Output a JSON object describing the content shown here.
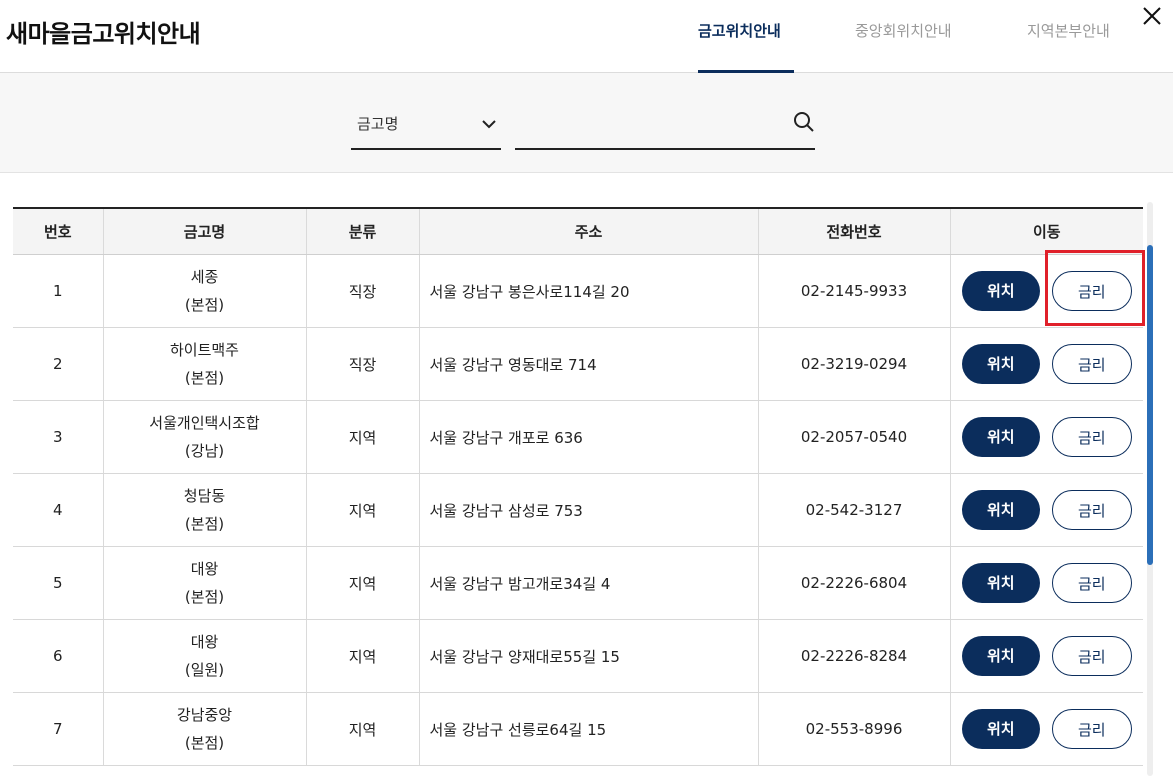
{
  "header": {
    "title": "새마을금고위치안내",
    "tabs": [
      {
        "label": "금고위치안내",
        "active": true
      },
      {
        "label": "중앙회위치안내",
        "active": false
      },
      {
        "label": "지역본부안내",
        "active": false
      }
    ],
    "close_icon": "close-icon"
  },
  "search": {
    "select_value": "금고명",
    "input_value": "",
    "search_icon": "search-icon"
  },
  "table": {
    "columns": [
      "번호",
      "금고명",
      "분류",
      "주소",
      "전화번호",
      "이동"
    ],
    "rows": [
      {
        "no": "1",
        "name": "세종",
        "branch": "(본점)",
        "type": "직장",
        "address": "서울 강남구 봉은사로114길 20",
        "phone": "02-2145-9933",
        "btn_location": "위치",
        "btn_rate": "금리"
      },
      {
        "no": "2",
        "name": "하이트맥주",
        "branch": "(본점)",
        "type": "직장",
        "address": "서울 강남구 영동대로 714",
        "phone": "02-3219-0294",
        "btn_location": "위치",
        "btn_rate": "금리"
      },
      {
        "no": "3",
        "name": "서울개인택시조합",
        "branch": "(강남)",
        "type": "지역",
        "address": "서울 강남구 개포로 636",
        "phone": "02-2057-0540",
        "btn_location": "위치",
        "btn_rate": "금리"
      },
      {
        "no": "4",
        "name": "청담동",
        "branch": "(본점)",
        "type": "지역",
        "address": "서울 강남구 삼성로 753",
        "phone": "02-542-3127",
        "btn_location": "위치",
        "btn_rate": "금리"
      },
      {
        "no": "5",
        "name": "대왕",
        "branch": "(본점)",
        "type": "지역",
        "address": "서울 강남구 밤고개로34길 4",
        "phone": "02-2226-6804",
        "btn_location": "위치",
        "btn_rate": "금리"
      },
      {
        "no": "6",
        "name": "대왕",
        "branch": "(일원)",
        "type": "지역",
        "address": "서울 강남구 양재대로55길 15",
        "phone": "02-2226-8284",
        "btn_location": "위치",
        "btn_rate": "금리"
      },
      {
        "no": "7",
        "name": "강남중앙",
        "branch": "(본점)",
        "type": "지역",
        "address": "서울 강남구 선릉로64길 15",
        "phone": "02-553-8996",
        "btn_location": "위치",
        "btn_rate": "금리"
      }
    ]
  },
  "colors": {
    "primary_navy": "#0b2d5c",
    "highlight_red": "#e0202a",
    "scrollbar_blue": "#2b6fb8"
  }
}
